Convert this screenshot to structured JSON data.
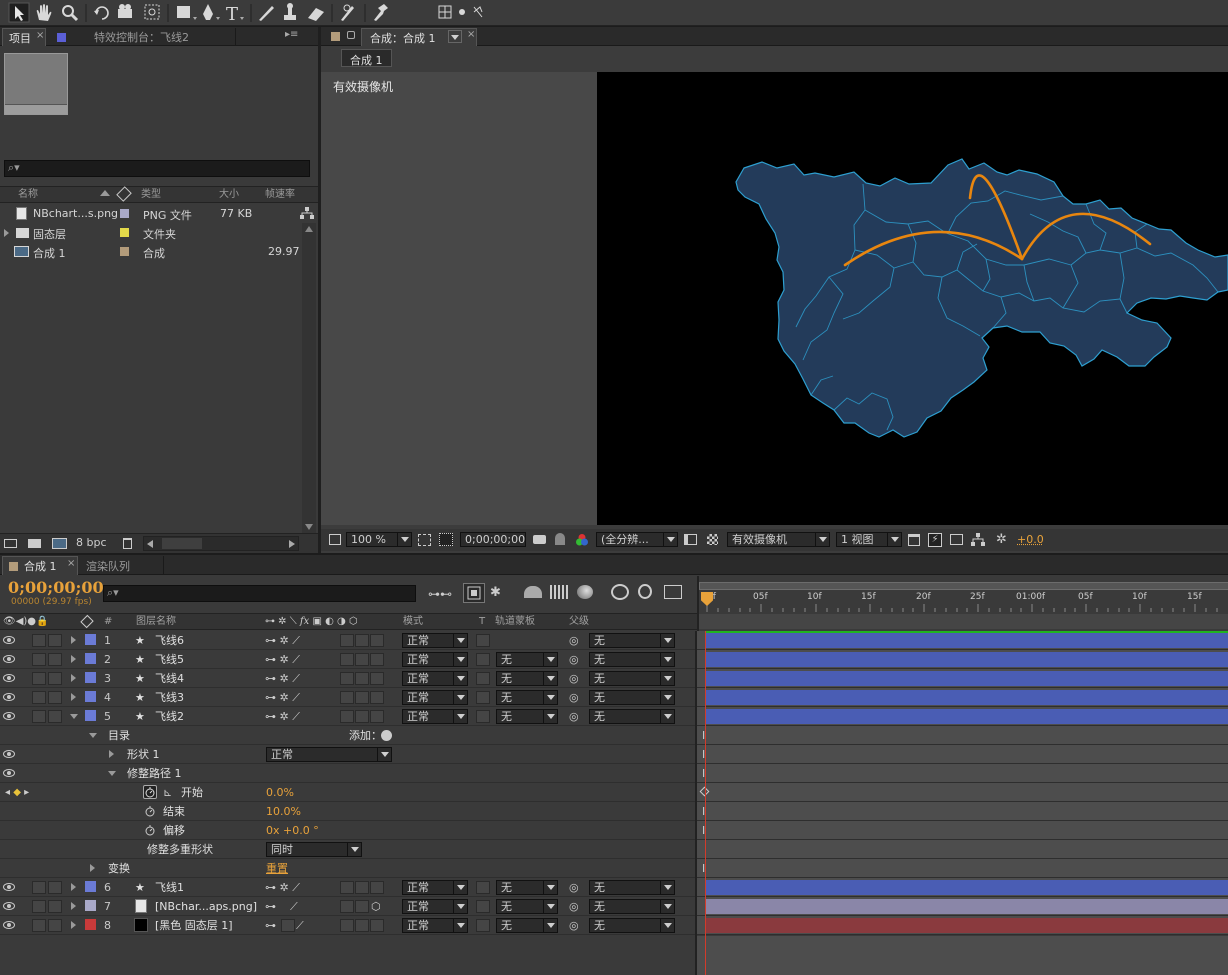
{
  "project_panel": {
    "tab_label": "项目",
    "effects_tab_label": "特效控制台：飞线2",
    "search_placeholder": "",
    "columns": {
      "name": "名称",
      "type": "类型",
      "size": "大小",
      "framerate": "帧速率"
    },
    "items": [
      {
        "name": "NBchart...s.png",
        "type": "PNG 文件",
        "size": "77 KB",
        "framerate": "",
        "label_color": "#a9a9c8"
      },
      {
        "name": "固态层",
        "type": "文件夹",
        "size": "",
        "framerate": "",
        "label_color": "#e3d94a"
      },
      {
        "name": "合成 1",
        "type": "合成",
        "size": "",
        "framerate": "29.97",
        "label_color": "#b39c7b"
      }
    ],
    "bpc_label": "8 bpc"
  },
  "comp_panel": {
    "tab_label": "合成：合成 1",
    "sub_tab_label": "合成 1",
    "camera_label": "有效摄像机",
    "viewer_toolbar": {
      "zoom": "100 %",
      "timecode": "0;00;00;00",
      "resolution": "(全分辨...",
      "camera": "有效摄像机",
      "views": "1 视图",
      "exposure": "+0.0"
    }
  },
  "timeline": {
    "tab_label": "合成 1",
    "render_queue_tab": "渲染队列",
    "current_time": "0;00;00;00",
    "frame_info": "00000 (29.97 fps)",
    "header": {
      "num": "#",
      "layer_name": "图层名称",
      "mode": "模式",
      "t": "T",
      "track_matte": "轨道蒙板",
      "parent": "父级"
    },
    "ruler_labels": [
      "0f",
      "05f",
      "10f",
      "15f",
      "20f",
      "25f",
      "01:00f",
      "05f",
      "10f",
      "15f"
    ],
    "layers": [
      {
        "index": "1",
        "name": "飞线6",
        "color": "#6b7bd6",
        "mode": "正常",
        "matte": "",
        "parent": "无",
        "bar_color": "#4a5db4",
        "expanded": false
      },
      {
        "index": "2",
        "name": "飞线5",
        "color": "#6b7bd6",
        "mode": "正常",
        "matte": "无",
        "parent": "无",
        "bar_color": "#4a5db4",
        "expanded": false
      },
      {
        "index": "3",
        "name": "飞线4",
        "color": "#6b7bd6",
        "mode": "正常",
        "matte": "无",
        "parent": "无",
        "bar_color": "#4a5db4",
        "expanded": false
      },
      {
        "index": "4",
        "name": "飞线3",
        "color": "#6b7bd6",
        "mode": "正常",
        "matte": "无",
        "parent": "无",
        "bar_color": "#4a5db4",
        "expanded": false
      },
      {
        "index": "5",
        "name": "飞线2",
        "color": "#6b7bd6",
        "mode": "正常",
        "matte": "无",
        "parent": "无",
        "bar_color": "#4a5db4",
        "expanded": true
      }
    ],
    "layers_after": [
      {
        "index": "6",
        "name": "飞线1",
        "color": "#6b7bd6",
        "mode": "正常",
        "matte": "无",
        "parent": "无",
        "bar_color": "#4a5db4",
        "icon": "star"
      },
      {
        "index": "7",
        "name": "[NBchar...aps.png]",
        "color": "#a9a9c8",
        "mode": "正常",
        "matte": "无",
        "parent": "无",
        "bar_color": "#8a86a8",
        "icon": "png"
      },
      {
        "index": "8",
        "name": "[黑色 固态层 1]",
        "color": "#c83a3a",
        "mode": "正常",
        "matte": "无",
        "parent": "无",
        "bar_color": "#8a3a3e",
        "icon": "solid"
      }
    ],
    "properties": {
      "contents": "目录",
      "add_label": "添加：",
      "shape": "形状 1",
      "shape_mode": "正常",
      "trim": "修整路径 1",
      "start_label": "开始",
      "start_value": "0.0%",
      "end_label": "结束",
      "end_value": "10.0%",
      "offset_label": "偏移",
      "offset_value": "0x +0.0 °",
      "trim_multiple_label": "修整多重形状",
      "trim_multiple_value": "同时",
      "transform_label": "变换",
      "reset_label": "重置"
    }
  }
}
